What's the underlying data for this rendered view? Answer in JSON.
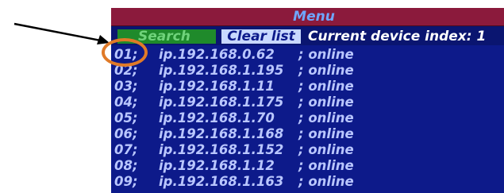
{
  "menu": {
    "title": "Menu"
  },
  "toolbar": {
    "search_label": "Search",
    "clear_label": "Clear list",
    "device_index_text": "Current device index: 1"
  },
  "devices": [
    {
      "index": "01;",
      "ip": "ip.192.168.0.62",
      "status": "; online"
    },
    {
      "index": "02;",
      "ip": "ip.192.168.1.195",
      "status": "; online"
    },
    {
      "index": "03;",
      "ip": "ip.192.168.1.11",
      "status": "; online"
    },
    {
      "index": "04;",
      "ip": "ip.192.168.1.175",
      "status": "; online"
    },
    {
      "index": "05;",
      "ip": "ip.192.168.1.70",
      "status": "; online"
    },
    {
      "index": "06;",
      "ip": "ip.192.168.1.168",
      "status": "; online"
    },
    {
      "index": "07;",
      "ip": "ip.192.168.1.152",
      "status": "; online"
    },
    {
      "index": "08;",
      "ip": "ip.192.168.1.12",
      "status": "; online"
    },
    {
      "index": "09;",
      "ip": "ip.192.168.1.163",
      "status": "; online"
    }
  ],
  "colors": {
    "screen_bg": "#0d1a8a",
    "menu_bar": "#8b1a3c",
    "search_button": "#1f8a2b",
    "clear_button": "#c8d8ff",
    "annotation": "#e07a28"
  },
  "icons": {
    "annotation_arrow": "arrow-icon",
    "annotation_circle": "circle-highlight"
  }
}
